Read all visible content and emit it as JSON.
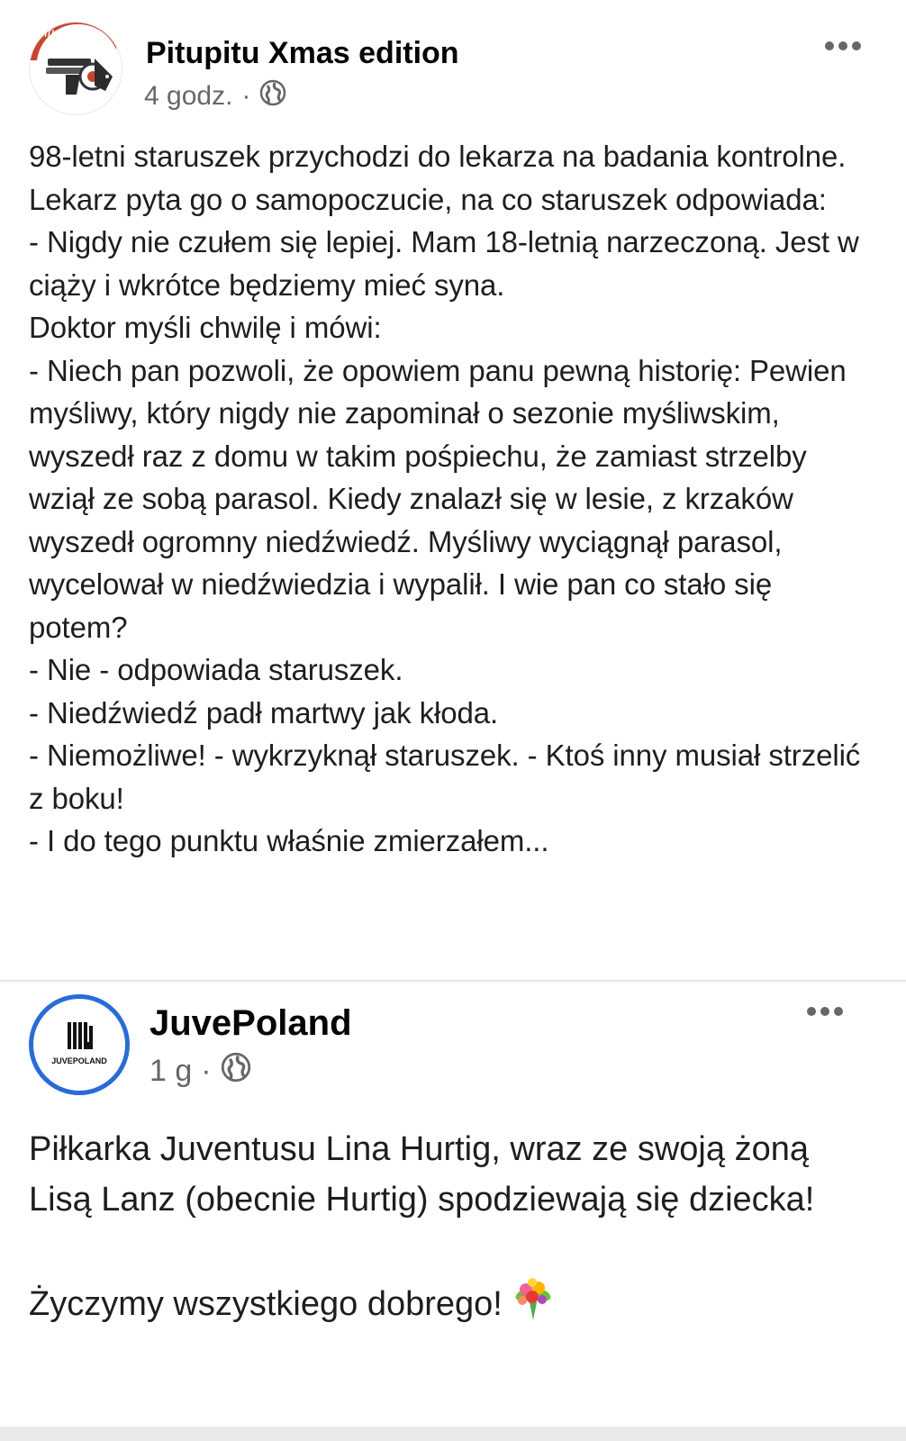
{
  "posts": [
    {
      "author": "Pitupitu Xmas edition",
      "avatar_text": "pitupitu",
      "timestamp": "4 godz.",
      "separator": "·",
      "visibility_icon": "globe-icon",
      "more_icon": "more-options-icon",
      "text": "98-letni staruszek przychodzi do lekarza na badania kontrolne. Lekarz pyta go o samopoczucie, na co staruszek odpowiada:\n- Nigdy nie czułem się lepiej. Mam 18-letnią narzeczoną. Jest w ciąży i wkrótce będziemy mieć syna.\nDoktor myśli chwilę i mówi:\n- Niech pan pozwoli, że opowiem panu pewną historię: Pewien myśliwy, który nigdy nie zapominał o sezonie myśliwskim, wyszedł raz z domu w takim pośpiechu, że zamiast strzelby wziął ze sobą parasol. Kiedy znalazł się w lesie, z krzaków wyszedł ogromny niedźwiedź. Myśliwy wyciągnął parasol, wycelował w niedźwiedzia i wypalił. I wie pan co stało się potem?\n- Nie - odpowiada staruszek.\n- Niedźwiedź padł martwy jak kłoda.\n- Niemożliwe! - wykrzyknął staruszek. - Ktoś inny musiał strzelić z boku!\n- I do tego punktu właśnie zmierzałem..."
    },
    {
      "author": "JuvePoland",
      "avatar_text": "JUVEPOLAND",
      "timestamp": "1 g",
      "separator": "·",
      "visibility_icon": "globe-icon",
      "more_icon": "more-options-icon",
      "text": "Piłkarka Juventusu Lina Hurtig, wraz ze swoją żoną Lisą Lanz (obecnie Hurtig) spodziewają się dziecka!\n\nŻyczymy wszystkiego dobrego!",
      "emoji_icon": "bouquet-icon"
    }
  ],
  "colors": {
    "text_primary": "#050505",
    "text_secondary": "#65676b",
    "juve_ring": "#2a6bd6",
    "pitupitu_red": "#c9452f"
  }
}
